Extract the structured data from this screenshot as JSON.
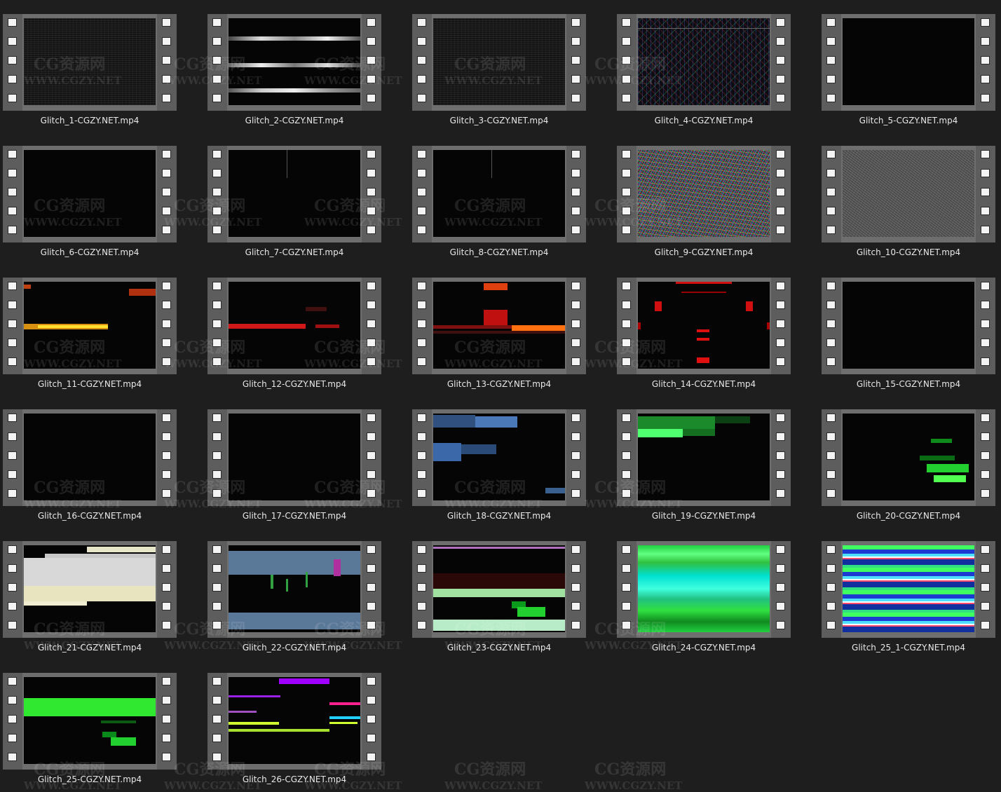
{
  "watermark": {
    "brand": "CG资源网",
    "url": "WWW.CGZY.NET"
  },
  "files": [
    {
      "name": "Glitch_1-CGZY.NET.mp4",
      "thumb": "dark-static"
    },
    {
      "name": "Glitch_2-CGZY.NET.mp4",
      "thumb": "white-streak-lines"
    },
    {
      "name": "Glitch_3-CGZY.NET.mp4",
      "thumb": "faint-dot-noise"
    },
    {
      "name": "Glitch_4-CGZY.NET.mp4",
      "thumb": "sparse-color-noise"
    },
    {
      "name": "Glitch_5-CGZY.NET.mp4",
      "thumb": "black"
    },
    {
      "name": "Glitch_6-CGZY.NET.mp4",
      "thumb": "black"
    },
    {
      "name": "Glitch_7-CGZY.NET.mp4",
      "thumb": "faint-vertical-line"
    },
    {
      "name": "Glitch_8-CGZY.NET.mp4",
      "thumb": "faint-vertical-line"
    },
    {
      "name": "Glitch_9-CGZY.NET.mp4",
      "thumb": "rgb-noise"
    },
    {
      "name": "Glitch_10-CGZY.NET.mp4",
      "thumb": "gray-noise"
    },
    {
      "name": "Glitch_11-CGZY.NET.mp4",
      "thumb": "orange-yellow-bar"
    },
    {
      "name": "Glitch_12-CGZY.NET.mp4",
      "thumb": "red-bar"
    },
    {
      "name": "Glitch_13-CGZY.NET.mp4",
      "thumb": "red-orange-blocks"
    },
    {
      "name": "Glitch_14-CGZY.NET.mp4",
      "thumb": "red-hud"
    },
    {
      "name": "Glitch_15-CGZY.NET.mp4",
      "thumb": "black"
    },
    {
      "name": "Glitch_16-CGZY.NET.mp4",
      "thumb": "black"
    },
    {
      "name": "Glitch_17-CGZY.NET.mp4",
      "thumb": "black"
    },
    {
      "name": "Glitch_18-CGZY.NET.mp4",
      "thumb": "blue-blocks"
    },
    {
      "name": "Glitch_19-CGZY.NET.mp4",
      "thumb": "green-bar-top"
    },
    {
      "name": "Glitch_20-CGZY.NET.mp4",
      "thumb": "green-small-blocks"
    },
    {
      "name": "Glitch_21-CGZY.NET.mp4",
      "thumb": "cream-bands"
    },
    {
      "name": "Glitch_22-CGZY.NET.mp4",
      "thumb": "slate-bands"
    },
    {
      "name": "Glitch_23-CGZY.NET.mp4",
      "thumb": "mint-bands"
    },
    {
      "name": "Glitch_24-CGZY.NET.mp4",
      "thumb": "green-cyan-fill"
    },
    {
      "name": "Glitch_25_1-CGZY.NET.mp4",
      "thumb": "multicolor-stripes"
    },
    {
      "name": "Glitch_25-CGZY.NET.mp4",
      "thumb": "green-wide-bar"
    },
    {
      "name": "Glitch_26-CGZY.NET.mp4",
      "thumb": "neon-lines"
    }
  ]
}
